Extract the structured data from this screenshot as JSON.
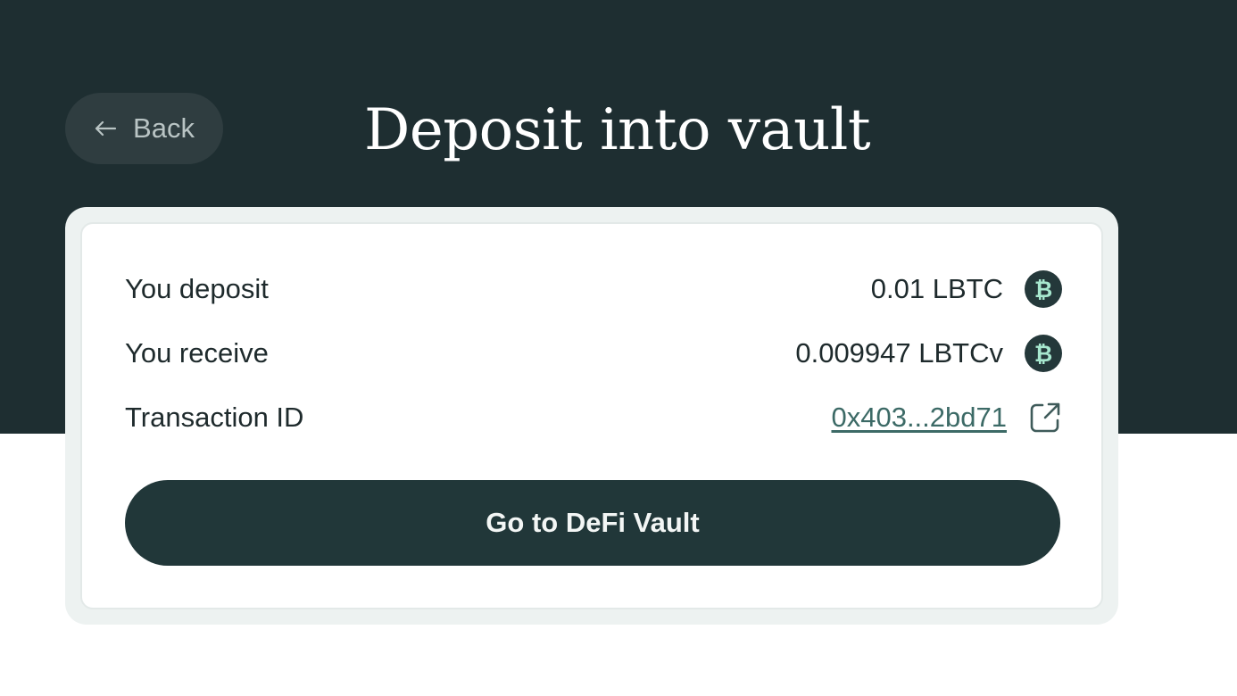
{
  "header": {
    "back_label": "Back",
    "title": "Deposit into vault"
  },
  "summary": {
    "deposit": {
      "label": "You deposit",
      "value": "0.01 LBTC",
      "icon": "bitcoin-icon"
    },
    "receive": {
      "label": "You receive",
      "value": "0.009947 LBTCv",
      "icon": "bitcoin-icon"
    },
    "transaction": {
      "label": "Transaction ID",
      "value": "0x403...2bd71",
      "icon": "external-link-icon"
    }
  },
  "action": {
    "button_label": "Go to DeFi Vault"
  },
  "colors": {
    "hero_background": "#1e2e31",
    "button_background": "#213739",
    "link": "#3c6a66",
    "coin_glyph": "#a7e8cf"
  }
}
